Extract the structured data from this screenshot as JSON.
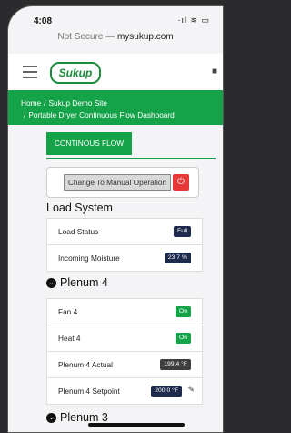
{
  "statusbar": {
    "time": "4:08",
    "icons": "·ıl ≋ ▭"
  },
  "url": {
    "prefix": "Not Secure — ",
    "domain": "mysukup.com"
  },
  "header": {
    "logo": "Sukup",
    "user_icon": "user-icon"
  },
  "breadcrumb": {
    "home": "Home",
    "site": "Sukup Demo Site",
    "page": "Portable Dryer Continuous Flow Dashboard"
  },
  "tab": {
    "label": "CONTINOUS FLOW"
  },
  "manual": {
    "button": "Change To Manual Operation",
    "power_icon": "power-icon"
  },
  "load_system": {
    "title": "Load System",
    "rows": [
      {
        "label": "Load Status",
        "value": "Full"
      },
      {
        "label": "Incoming Moisture",
        "value": "23.7 %"
      }
    ]
  },
  "plenum4": {
    "title": "Plenum 4",
    "rows": [
      {
        "label": "Fan 4",
        "value": "On"
      },
      {
        "label": "Heat 4",
        "value": "On"
      },
      {
        "label": "Plenum 4 Actual",
        "value": "199.4 °F"
      },
      {
        "label": "Plenum 4 Setpoint",
        "value": "200.0 °F"
      }
    ]
  },
  "plenum3": {
    "title": "Plenum 3"
  },
  "colors": {
    "green": "#15a34a",
    "navy": "#1d2a4c",
    "red": "#e53939"
  }
}
